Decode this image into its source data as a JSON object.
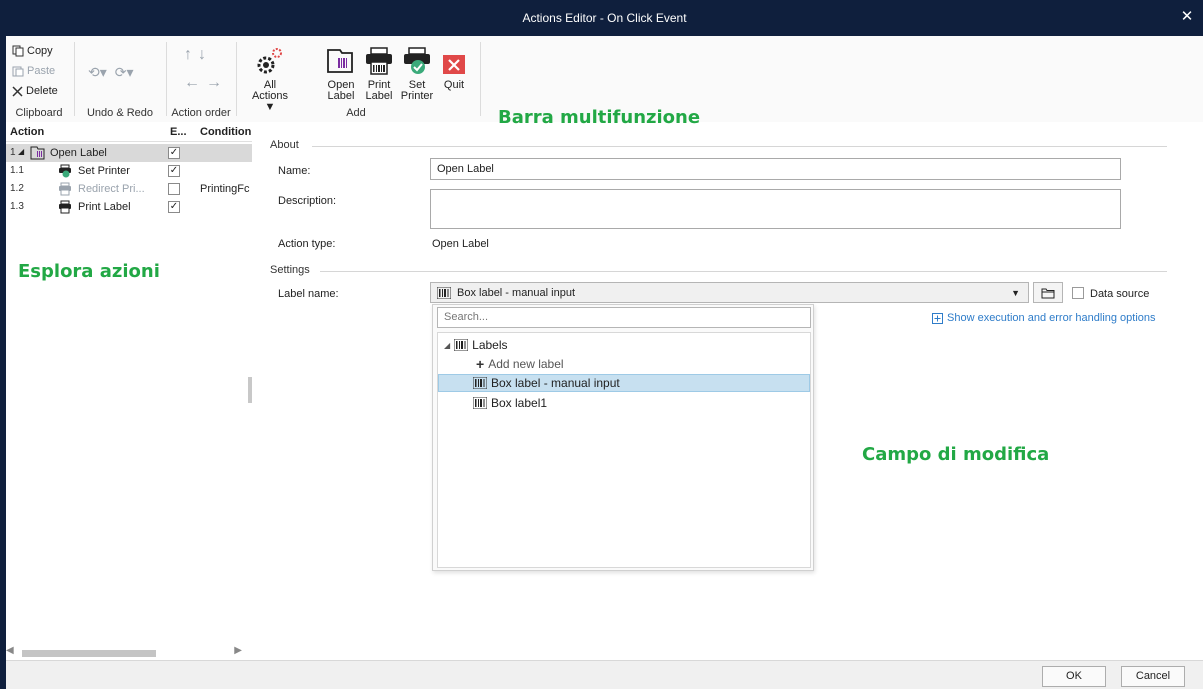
{
  "window": {
    "title": "Actions Editor - On Click Event"
  },
  "ribbon": {
    "clipboard": {
      "copy": "Copy",
      "paste": "Paste",
      "delete": "Delete",
      "group_label": "Clipboard"
    },
    "undo_redo": {
      "group_label": "Undo & Redo"
    },
    "action_order": {
      "group_label": "Action order"
    },
    "add": {
      "all_actions": [
        "All",
        "Actions ▼"
      ],
      "open_label": [
        "Open",
        "Label"
      ],
      "print_label": [
        "Print",
        "Label"
      ],
      "set_printer": [
        "Set",
        "Printer"
      ],
      "quit": "Quit",
      "group_label": "Add"
    }
  },
  "actions_panel": {
    "columns": [
      "Action",
      "E...",
      "Condition"
    ],
    "rows": [
      {
        "num": "1",
        "name": "Open Label",
        "enabled": true,
        "condition": "",
        "selected": true
      },
      {
        "num": "1.1",
        "name": "Set Printer",
        "enabled": true,
        "condition": "",
        "selected": false
      },
      {
        "num": "1.2",
        "name": "Redirect Pri...",
        "enabled": false,
        "condition": "PrintingFc",
        "selected": false
      },
      {
        "num": "1.3",
        "name": "Print Label",
        "enabled": true,
        "condition": "",
        "selected": false
      }
    ]
  },
  "annotations": {
    "ribbon": "Barra multifunzione",
    "explorer": "Esplora azioni",
    "editor": "Campo di modifica"
  },
  "editor": {
    "about_section": "About",
    "name_label": "Name:",
    "name_value": "Open Label",
    "description_label": "Description:",
    "description_value": "",
    "action_type_label": "Action type:",
    "action_type_value": "Open Label",
    "settings_section": "Settings",
    "label_name_label": "Label name:",
    "label_name_value": "Box label - manual input",
    "data_source": "Data source",
    "show_options": "Show execution and error handling options"
  },
  "dropdown": {
    "search_placeholder": "Search...",
    "root": "Labels",
    "add_new": "Add new label",
    "items": [
      "Box label - manual input",
      "Box label1"
    ]
  },
  "footer": {
    "ok": "OK",
    "cancel": "Cancel"
  },
  "colors": {
    "titlebar": "#0f1f3d",
    "accent_green": "#22a845",
    "link_blue": "#2e7cc9",
    "selection": "#c7e0f0",
    "quit_red": "#e04848",
    "check_green": "#3aaa7a"
  }
}
